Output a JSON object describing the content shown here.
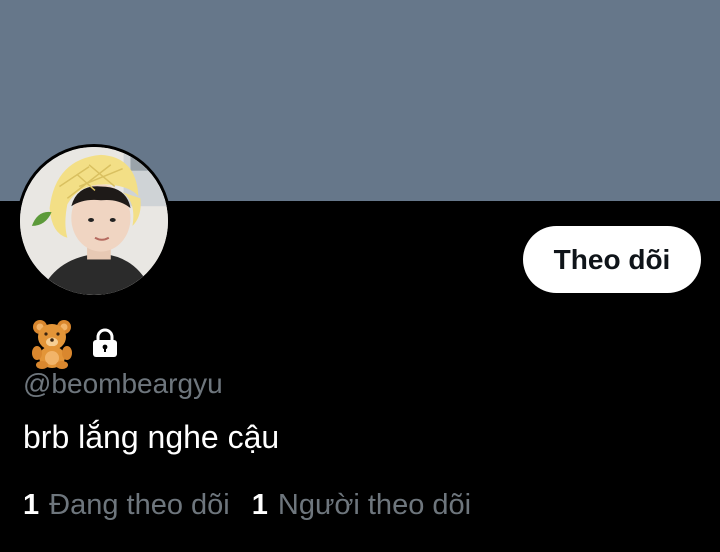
{
  "profile": {
    "name_emoji": "teddy-bear",
    "protected": true,
    "handle": "@beombeargyu",
    "bio": "brb lắng nghe cậu",
    "follow_button": "Theo dõi"
  },
  "stats": {
    "following_count": "1",
    "following_label": "Đang theo dõi",
    "followers_count": "1",
    "followers_label": "Người theo dõi"
  },
  "colors": {
    "banner": "#66778a",
    "background": "#000000",
    "muted_text": "#6e767d",
    "button_bg": "#ffffff"
  }
}
